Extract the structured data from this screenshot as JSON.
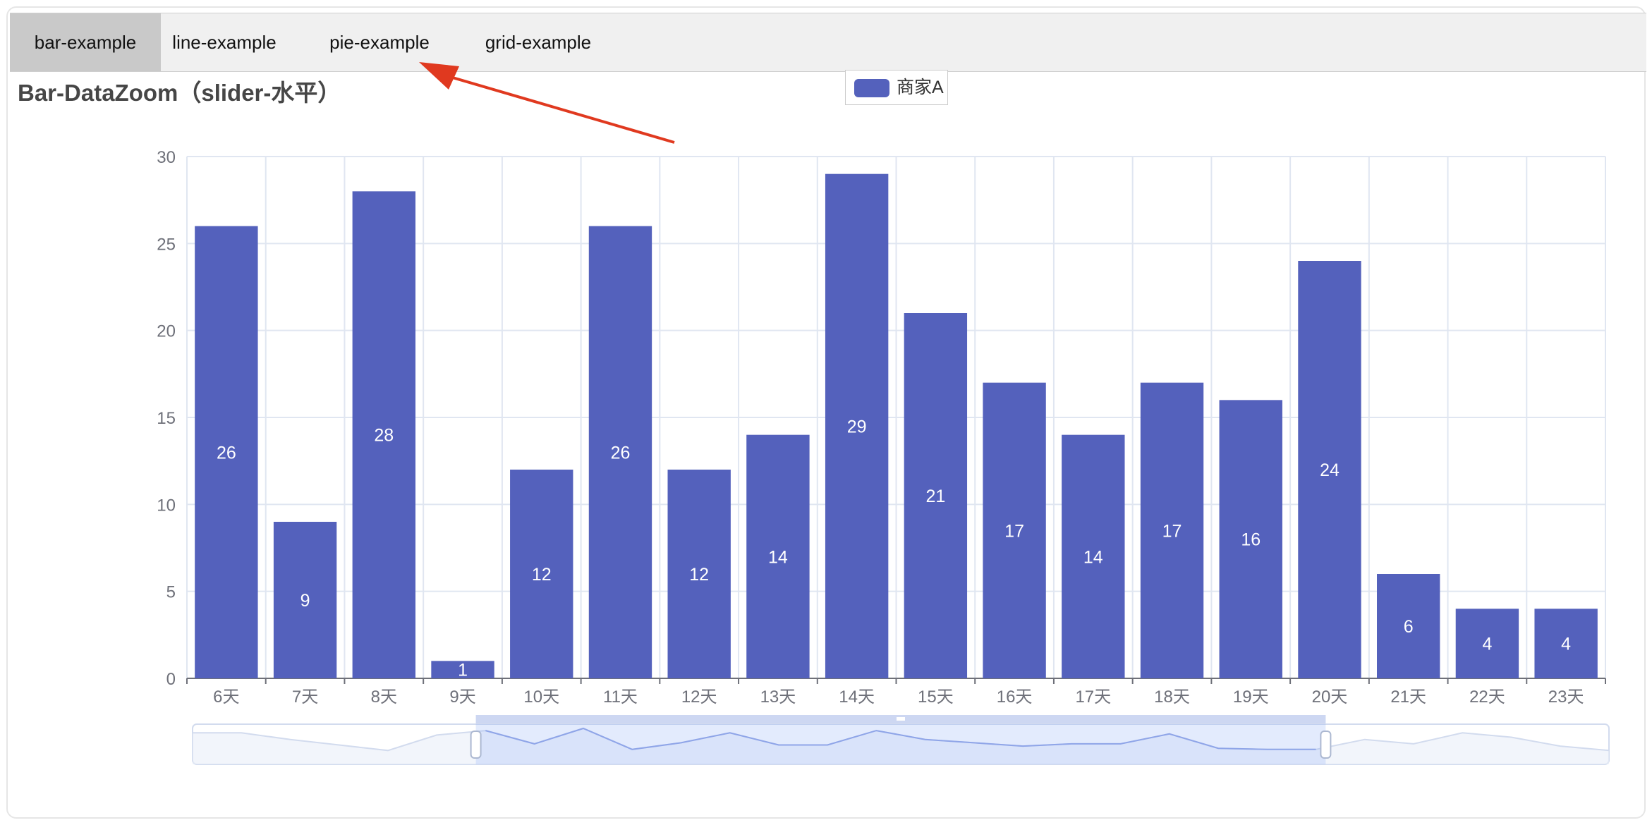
{
  "tabs": [
    {
      "label": "bar-example",
      "active": true
    },
    {
      "label": "line-example",
      "active": false
    },
    {
      "label": "pie-example",
      "active": false
    },
    {
      "label": "grid-example",
      "active": false
    }
  ],
  "colors": {
    "bar": "#5461bc",
    "annotation_arrow": "#e0391f",
    "active_tab": "#c9c9c9",
    "tab_bar": "#f0f0f0"
  },
  "chart_data": {
    "type": "bar",
    "title": "Bar-DataZoom（slider-水平）",
    "xlabel": "",
    "ylabel": "",
    "categories": [
      "6天",
      "7天",
      "8天",
      "9天",
      "10天",
      "11天",
      "12天",
      "13天",
      "14天",
      "15天",
      "16天",
      "17天",
      "18天",
      "19天",
      "20天",
      "21天",
      "22天",
      "23天"
    ],
    "series": [
      {
        "name": "商家A",
        "values": [
          26,
          9,
          28,
          1,
          12,
          26,
          12,
          14,
          29,
          21,
          17,
          14,
          17,
          16,
          24,
          6,
          4,
          4
        ]
      }
    ],
    "ylim": [
      0,
      30
    ],
    "yticks": [
      0,
      5,
      10,
      15,
      20,
      25,
      30
    ],
    "grid": true,
    "legend_position": "top-center",
    "data_labels": "inside",
    "datazoom": {
      "type": "slider",
      "orientation": "horizontal",
      "start_percent": 20,
      "end_percent": 80,
      "full_series_overview": [
        26,
        26,
        20,
        15,
        10,
        24,
        28,
        16,
        30,
        11,
        17,
        26,
        15,
        15,
        28,
        20,
        17,
        14,
        16,
        16,
        25,
        12,
        11,
        11,
        20,
        16,
        26,
        22,
        14,
        10
      ]
    }
  }
}
